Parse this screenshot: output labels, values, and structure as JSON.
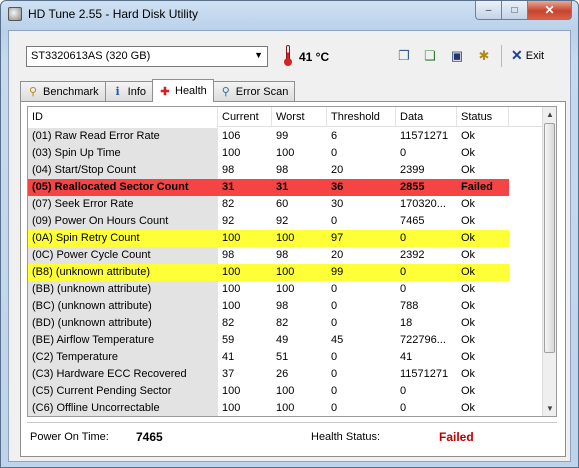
{
  "window": {
    "title": "HD Tune 2.55 - Hard Disk Utility",
    "minimize": "–",
    "maximize": "□",
    "close": "✕"
  },
  "toolbar": {
    "drive": "ST3320613AS (320 GB)",
    "temperature": "41 °C",
    "exit_label": "Exit"
  },
  "tabs": [
    {
      "label": "Benchmark",
      "icon": "gauge-icon"
    },
    {
      "label": "Info",
      "icon": "info-icon"
    },
    {
      "label": "Health",
      "icon": "health-cross-icon",
      "active": true
    },
    {
      "label": "Error Scan",
      "icon": "magnifier-icon"
    }
  ],
  "table": {
    "columns": [
      "ID",
      "Current",
      "Worst",
      "Threshold",
      "Data",
      "Status"
    ],
    "rows": [
      {
        "id": "(01) Raw Read Error Rate",
        "current": "106",
        "worst": "99",
        "threshold": "6",
        "data": "11571271",
        "status": "Ok",
        "state": "normal"
      },
      {
        "id": "(03) Spin Up Time",
        "current": "100",
        "worst": "100",
        "threshold": "0",
        "data": "0",
        "status": "Ok",
        "state": "normal"
      },
      {
        "id": "(04) Start/Stop Count",
        "current": "98",
        "worst": "98",
        "threshold": "20",
        "data": "2399",
        "status": "Ok",
        "state": "normal"
      },
      {
        "id": "(05) Reallocated Sector Count",
        "current": "31",
        "worst": "31",
        "threshold": "36",
        "data": "2855",
        "status": "Failed",
        "state": "fail"
      },
      {
        "id": "(07) Seek Error Rate",
        "current": "82",
        "worst": "60",
        "threshold": "30",
        "data": "170320...",
        "status": "Ok",
        "state": "normal"
      },
      {
        "id": "(09) Power On Hours Count",
        "current": "92",
        "worst": "92",
        "threshold": "0",
        "data": "7465",
        "status": "Ok",
        "state": "normal"
      },
      {
        "id": "(0A) Spin Retry Count",
        "current": "100",
        "worst": "100",
        "threshold": "97",
        "data": "0",
        "status": "Ok",
        "state": "warn"
      },
      {
        "id": "(0C) Power Cycle Count",
        "current": "98",
        "worst": "98",
        "threshold": "20",
        "data": "2392",
        "status": "Ok",
        "state": "normal"
      },
      {
        "id": "(B8) (unknown attribute)",
        "current": "100",
        "worst": "100",
        "threshold": "99",
        "data": "0",
        "status": "Ok",
        "state": "warn"
      },
      {
        "id": "(BB) (unknown attribute)",
        "current": "100",
        "worst": "100",
        "threshold": "0",
        "data": "0",
        "status": "Ok",
        "state": "normal"
      },
      {
        "id": "(BC) (unknown attribute)",
        "current": "100",
        "worst": "98",
        "threshold": "0",
        "data": "788",
        "status": "Ok",
        "state": "normal"
      },
      {
        "id": "(BD) (unknown attribute)",
        "current": "82",
        "worst": "82",
        "threshold": "0",
        "data": "18",
        "status": "Ok",
        "state": "normal"
      },
      {
        "id": "(BE) Airflow Temperature",
        "current": "59",
        "worst": "49",
        "threshold": "45",
        "data": "722796...",
        "status": "Ok",
        "state": "normal"
      },
      {
        "id": "(C2) Temperature",
        "current": "41",
        "worst": "51",
        "threshold": "0",
        "data": "41",
        "status": "Ok",
        "state": "normal"
      },
      {
        "id": "(C3) Hardware ECC Recovered",
        "current": "37",
        "worst": "26",
        "threshold": "0",
        "data": "11571271",
        "status": "Ok",
        "state": "normal"
      },
      {
        "id": "(C5) Current Pending Sector",
        "current": "100",
        "worst": "100",
        "threshold": "0",
        "data": "0",
        "status": "Ok",
        "state": "normal"
      },
      {
        "id": "(C6) Offline Uncorrectable",
        "current": "100",
        "worst": "100",
        "threshold": "0",
        "data": "0",
        "status": "Ok",
        "state": "normal"
      }
    ]
  },
  "footer": {
    "power_on_label": "Power On Time:",
    "power_on_value": "7465",
    "health_label": "Health Status:",
    "health_value": "Failed"
  },
  "colors": {
    "fail_row": "#f44444",
    "warn_row": "#ffff37",
    "failed_text": "#c00000"
  }
}
